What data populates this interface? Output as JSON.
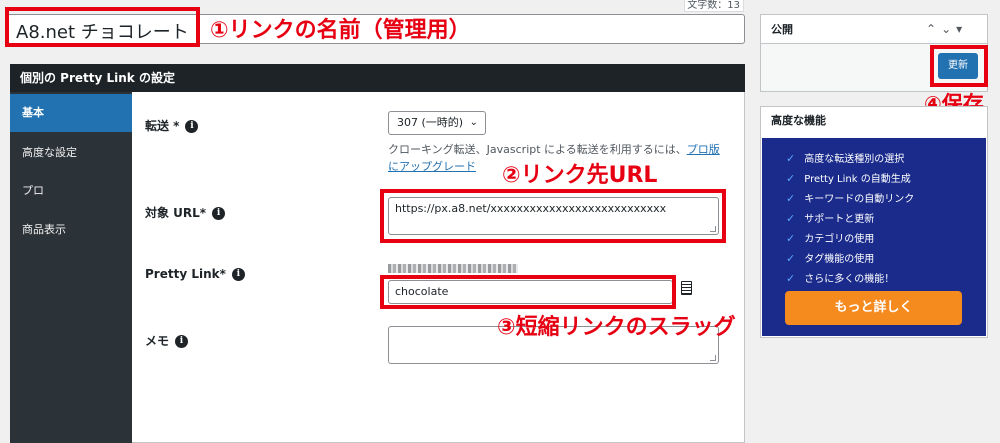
{
  "title": {
    "char_count": "文字数：13",
    "value": "A8.net チョコレート"
  },
  "annotations": {
    "a1": "①リンクの名前（管理用）",
    "a2": "②リンク先URL",
    "a3": "③短縮リンクのスラッグ",
    "a4": "④保存"
  },
  "settings": {
    "heading": "個別の Pretty Link の設定",
    "tabs": [
      "基本",
      "高度な設定",
      "プロ",
      "商品表示"
    ],
    "redirect": {
      "label": "転送 *",
      "selected": "307 (一時的)",
      "desc_text": "クローキング転送、Javascript による転送を利用するには、",
      "desc_link": "プロ版にアップグレード"
    },
    "target_url": {
      "label": "対象 URL*",
      "value": "https://px.a8.net/xxxxxxxxxxxxxxxxxxxxxxxxxxx"
    },
    "pretty_link": {
      "label": "Pretty Link*",
      "value": "chocolate"
    },
    "memo": {
      "label": "メモ",
      "value": ""
    }
  },
  "publish": {
    "heading": "公開",
    "update_label": "更新"
  },
  "advanced": {
    "heading": "高度な機能",
    "features": [
      "高度な転送種別の選択",
      "Pretty Link の自動生成",
      "キーワードの自動リンク",
      "サポートと更新",
      "カテゴリの使用",
      "タグ機能の使用",
      "さらに多くの機能！"
    ],
    "more_label": "もっと詳しく"
  },
  "colors": {
    "annotation_red": "#e60012",
    "accent_blue": "#2271b1",
    "promo_blue": "#1a2b8c",
    "promo_orange": "#f58a1f"
  }
}
